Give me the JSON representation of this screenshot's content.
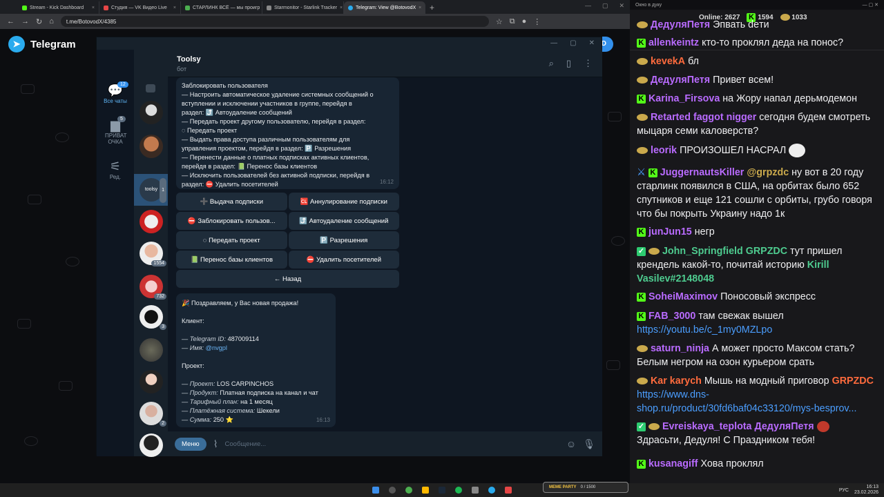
{
  "browser": {
    "tabs": [
      {
        "label": "Stream - Kick Dashboard",
        "color": "#53fc18"
      },
      {
        "label": "Студия — VK Видео Live",
        "color": "#e64646"
      },
      {
        "label": "СТАРЛИНК ВСЁ — мы проигр",
        "color": "#4caf50"
      },
      {
        "label": "Starmonitor - Starlink Tracker",
        "color": "#888888"
      },
      {
        "label": "Telegram: View @BotovodX",
        "color": "#2aabee"
      }
    ],
    "url": "t.me/BotovodX/4385"
  },
  "telegram": {
    "brand": "Telegram",
    "open_app_label": "AD",
    "nav": [
      {
        "label": "Все чаты",
        "count": "12"
      },
      {
        "label": "ПРИВАТ ОЧКА",
        "count": "5"
      },
      {
        "label": "Ред.",
        "count": ""
      }
    ],
    "avatar_badges": [
      "1554",
      "732",
      "3",
      "2"
    ],
    "chat_name": "Toolsy",
    "chat_status": "бот",
    "msg1": {
      "lines": [
        "Заблокировать пользователя",
        "— Настроить автоматическое удаление системных сообщений о",
        "вступлении и исключении участников в группе, перейдя в",
        "раздел: ⤴️ Автоудаление сообщений",
        "— Передать проект другому пользователю, перейдя в раздел:",
        "◌ Передать проект",
        "— Выдать права доступа различным пользователям для",
        "управления проектом, перейдя в раздел: 🅿️ Разрешения",
        "— Перенести данные о платных подписках активных клиентов,",
        "перейдя в раздел: 📗 Перенос базы клиентов",
        "— Исключить пользователей без активной подписки, перейдя в",
        "раздел: ⛔ Удалить посетителей"
      ],
      "time": "16:12"
    },
    "keyboard": [
      [
        "➕ Выдача подписки",
        "🆑 Аннулирование подписки"
      ],
      [
        "⛔ Заблокировать пользов...",
        "⤴️ Автоудаление сообщений"
      ],
      [
        "◌ Передать проект",
        "🅿️ Разрешения"
      ],
      [
        "📗 Перенос базы клиентов",
        "⛔ Удалить посетителей"
      ],
      [
        "← Назад"
      ]
    ],
    "msg2": {
      "title": "🎉 Поздравляем, у Вас новая продажа!",
      "client_header": "Клиент:",
      "tg_id_label": "— Telegram ID:",
      "tg_id": "487009114",
      "name_label": "— Имя:",
      "name": "@nvgpl",
      "project_header": "Проект:",
      "project_label": "— Проект:",
      "project": "LOS CARPINCHOS",
      "product_label": "— Продукт:",
      "product": "Платная подписка на канал и чат",
      "plan_label": "— Тарифный план:",
      "plan": "на 1 месяц",
      "payment_label": "— Платёжная система:",
      "payment": "Шекели",
      "sum_label": "— Сумма:",
      "sum": "250 ⭐",
      "time": "16:13"
    },
    "menu_label": "Меню",
    "input_placeholder": "Сообщение..."
  },
  "twitch": {
    "window_title": "Окно в дуку",
    "online_label": "Online:",
    "online": "2627",
    "kick_count": "1594",
    "vk_count": "1033",
    "messages": [
      {
        "user": "ДедуляПетя",
        "color": "#b96bff",
        "text": "Эпвать deти"
      },
      {
        "user": "allenkeintz",
        "color": "#b96bff",
        "text": "кто-то проклял деда на понос?"
      },
      {
        "user": "kevekA",
        "color": "#ff6b3d",
        "text": "бл"
      },
      {
        "user": "ДедуляПетя",
        "color": "#b96bff",
        "text": "Привет всем!"
      },
      {
        "user": "Karina_Firsova",
        "color": "#b96bff",
        "text": "на Жору напал дерьмодемон"
      },
      {
        "user": "Retarted faggot nigger",
        "color": "#b96bff",
        "text": "сегодня будем смотреть мыцаря семи каловерств?"
      },
      {
        "user": "leorik",
        "color": "#b96bff",
        "text": "ПРОИЗОШЕЛ НАСРАЛ"
      },
      {
        "user": "JuggernautsKiller",
        "color": "#b96bff",
        "mention": "@grpzdc",
        "text": "ну вот в 20 году старлинк появился в США, на орбитах было 652 спутников и еще 121 сошли с орбиты, грубо говоря что бы покрыть Украину надо 1к"
      },
      {
        "user": "junJun15",
        "color": "#b96bff",
        "text": "негр"
      },
      {
        "user": "John_Springfield",
        "color": "#4ecb8f",
        "mention": "GRPZDC",
        "text": "тут пришел крендель какой-то, почитай историю",
        "mention2": "Kirill Vasilev#2148048"
      },
      {
        "user": "SoheiMaximov",
        "color": "#b96bff",
        "text": "Поносовый экспресс"
      },
      {
        "user": "FAB_3000",
        "color": "#b96bff",
        "text": "там свежак вышел",
        "link": "https://youtu.be/c_1my0MZLpo"
      },
      {
        "user": "saturn_ninja",
        "color": "#b96bff",
        "text": "А может просто Максом стать? Белым негром на озон курьером срать"
      },
      {
        "user": "Kar karych",
        "color": "#ff6b3d",
        "text": "Мышь на модный приговор",
        "mention": "GRPZDC",
        "link": "https://www.dns-shop.ru/product/30fd6baf04c33120/mys-besprov..."
      },
      {
        "user": "Evreiskaya_teplota",
        "color": "#b96bff",
        "mention": "ДедуляПетя",
        "text": "Здрасьти, Дедуля! С Праздником тебя!"
      },
      {
        "user": "kusanagiff",
        "color": "#b96bff",
        "text": "Хова проклял"
      }
    ]
  },
  "taskbar": {
    "meme_party": "MEME PARTY",
    "meme_counter": "0 / 1500",
    "lang": "РУС",
    "time": "16:13",
    "date": "23.02.2026"
  }
}
